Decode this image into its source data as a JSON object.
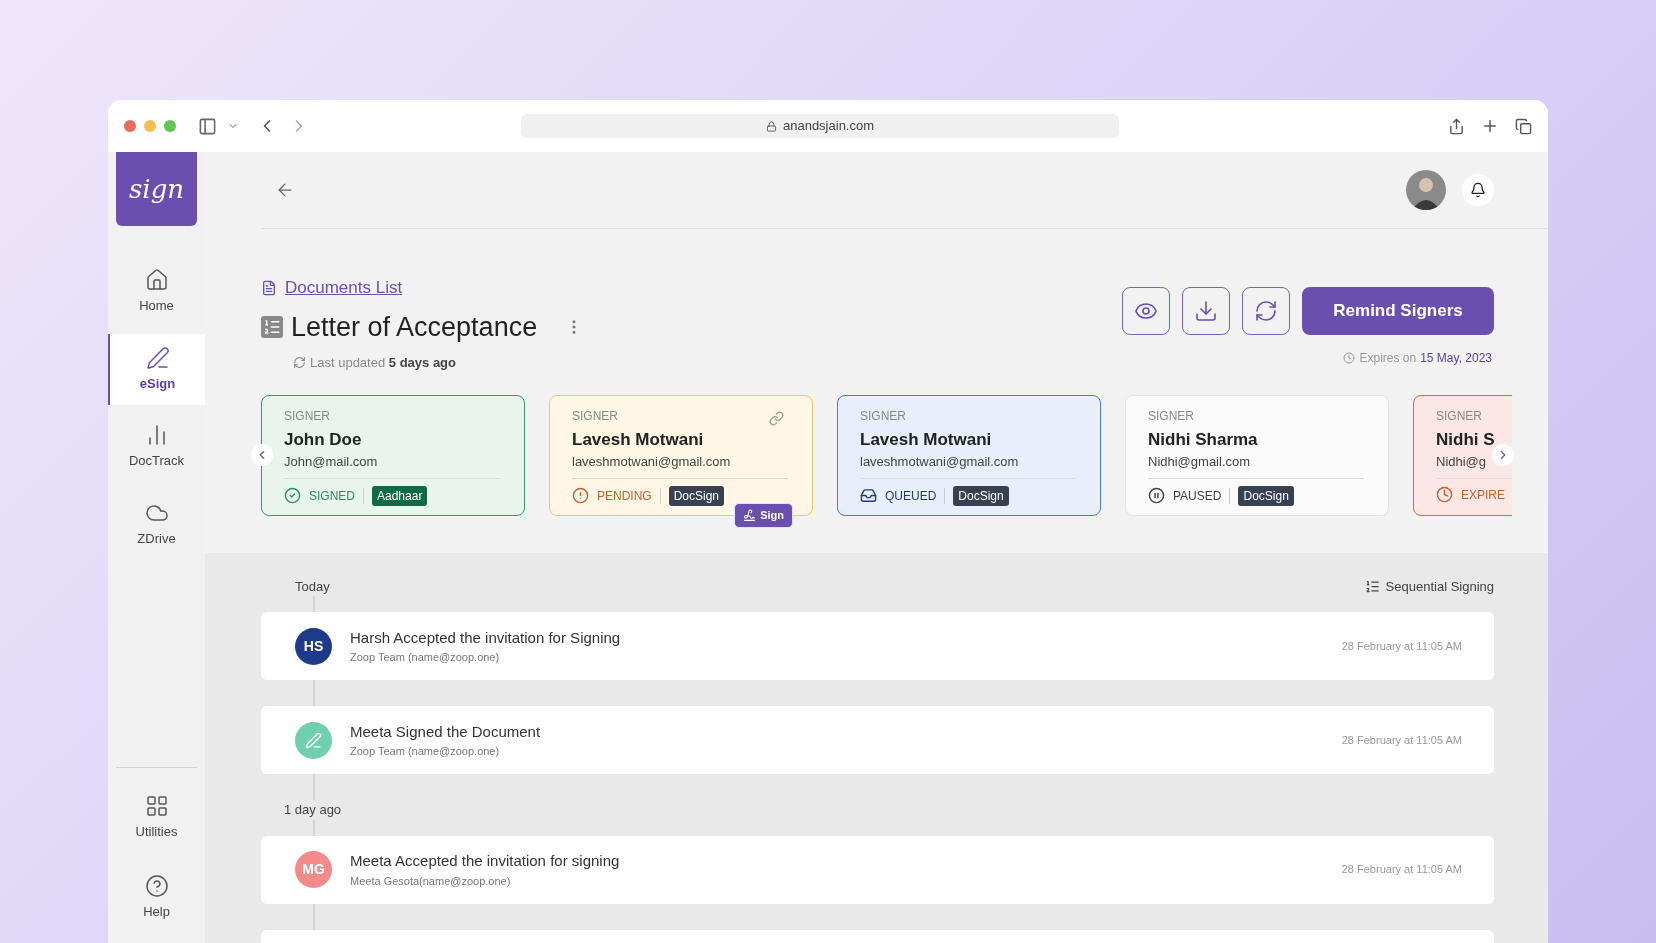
{
  "browser": {
    "url": "anandsjain.com"
  },
  "sidebar": {
    "logo": "sign",
    "items": [
      {
        "label": "Home",
        "selected": false
      },
      {
        "label": "eSign",
        "selected": true
      },
      {
        "label": "DocTrack",
        "selected": false
      },
      {
        "label": "ZDrive",
        "selected": false
      }
    ],
    "bottom_items": [
      {
        "label": "Utilities",
        "selected": false
      },
      {
        "label": "Help",
        "selected": false
      }
    ]
  },
  "document": {
    "breadcrumb": "Documents List",
    "title": "Letter of Acceptance",
    "last_updated": "Last updated **5 days ago**",
    "expires_label": "Expires on",
    "expires_date": "15 May, 2023",
    "remind_button": "Remind Signers"
  },
  "signers": [
    {
      "label": "SIGNER",
      "name": "John Doe",
      "email": "John@mail.com",
      "kind": "signed",
      "status": "SIGNED",
      "method": "Aadhaar"
    },
    {
      "label": "SIGNER",
      "name": "Lavesh Motwani",
      "email": "laveshmotwani@gmail.com",
      "kind": "pending",
      "status": "PENDING",
      "method": "DocSign",
      "link": true,
      "sign_button": "Sign"
    },
    {
      "label": "SIGNER",
      "name": "Lavesh Motwani",
      "email": "laveshmotwani@gmail.com",
      "kind": "queued",
      "status": "QUEUED",
      "method": "DocSign"
    },
    {
      "label": "SIGNER",
      "name": "Nidhi Sharma",
      "email": "Nidhi@gmail.com",
      "kind": "paused",
      "status": "PAUSED",
      "method": "DocSign"
    },
    {
      "label": "SIGNER",
      "name": "Nidhi S",
      "email": "Nidhi@g",
      "kind": "expired",
      "status": "EXPIRE"
    }
  ],
  "timeline": {
    "sequential_label": "Sequential Signing",
    "groups": [
      {
        "label": "Today",
        "events": [
          {
            "kind": "initials",
            "initials": "HS",
            "color": "#1e3a8a",
            "title": "Harsh Accepted the invitation for Signing",
            "subtitle": "Zoop Team (name@zoop.one)",
            "time": "28 February at 11:05 AM"
          },
          {
            "kind": "icon",
            "color": "#6fcfae",
            "title": "Meeta Signed the Document",
            "subtitle": "Zoop Team (name@zoop.one)",
            "time": "28 February at 11:05 AM"
          }
        ]
      },
      {
        "label": "1 day ago",
        "events": [
          {
            "kind": "initials",
            "initials": "MG",
            "color": "#f58a8a",
            "title": "Meeta Accepted the invitation for signing",
            "subtitle": "Meeta Gesota(name@zoop.one)",
            "time": "28 February at 11:05 AM"
          }
        ]
      }
    ]
  }
}
